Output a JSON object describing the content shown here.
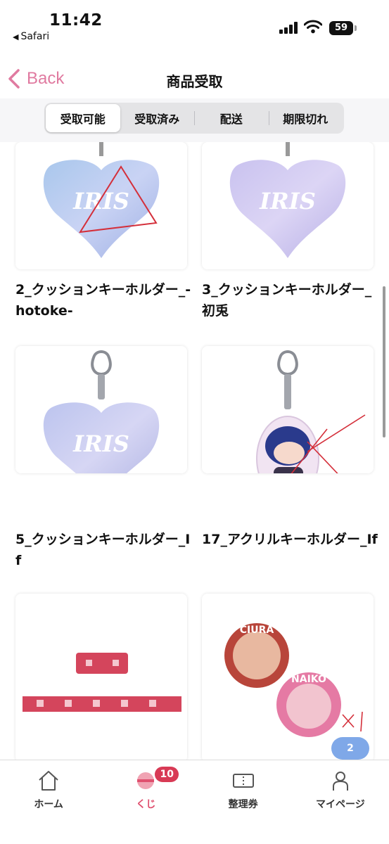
{
  "status_bar": {
    "time": "11:42",
    "back_app": "Safari",
    "battery": "59"
  },
  "nav": {
    "back_label": "Back",
    "title": "商品受取"
  },
  "segments": [
    {
      "label": "受取可能",
      "active": true
    },
    {
      "label": "受取済み",
      "active": false
    },
    {
      "label": "配送",
      "active": false
    },
    {
      "label": "期限切れ",
      "active": false
    }
  ],
  "items": [
    {
      "title": "2_クッションキーホルダー_-hotoke-",
      "image": "heart-keychain-blue",
      "logo_text": "IRIS"
    },
    {
      "title": "3_クッションキーホルダー_初兎",
      "image": "heart-keychain-purple",
      "logo_text": "IRIS"
    },
    {
      "title": "5_クッションキーホルダー_If",
      "image": "heart-keychain-lavender",
      "logo_text": "IRIS"
    },
    {
      "title": "17_アクリルキーホルダー_If",
      "image": "acrylic-keychain-character",
      "logo_text": ""
    },
    {
      "title": "",
      "image": "masking-tape"
    },
    {
      "title": "",
      "image": "can-badges",
      "badge_text_1": "CIURA",
      "badge_text_2": "NAIKO"
    }
  ],
  "floating_chip": "2",
  "tabbar": [
    {
      "label": "ホーム",
      "icon": "home-icon",
      "active": false
    },
    {
      "label": "くじ",
      "icon": "lottery-icon",
      "active": true,
      "badge": "10"
    },
    {
      "label": "整理券",
      "icon": "ticket-icon",
      "active": false
    },
    {
      "label": "マイページ",
      "icon": "person-icon",
      "active": false
    }
  ],
  "colors": {
    "accent": "#e07aa0",
    "badge": "#d83a55",
    "active_tab": "#e0506f"
  }
}
